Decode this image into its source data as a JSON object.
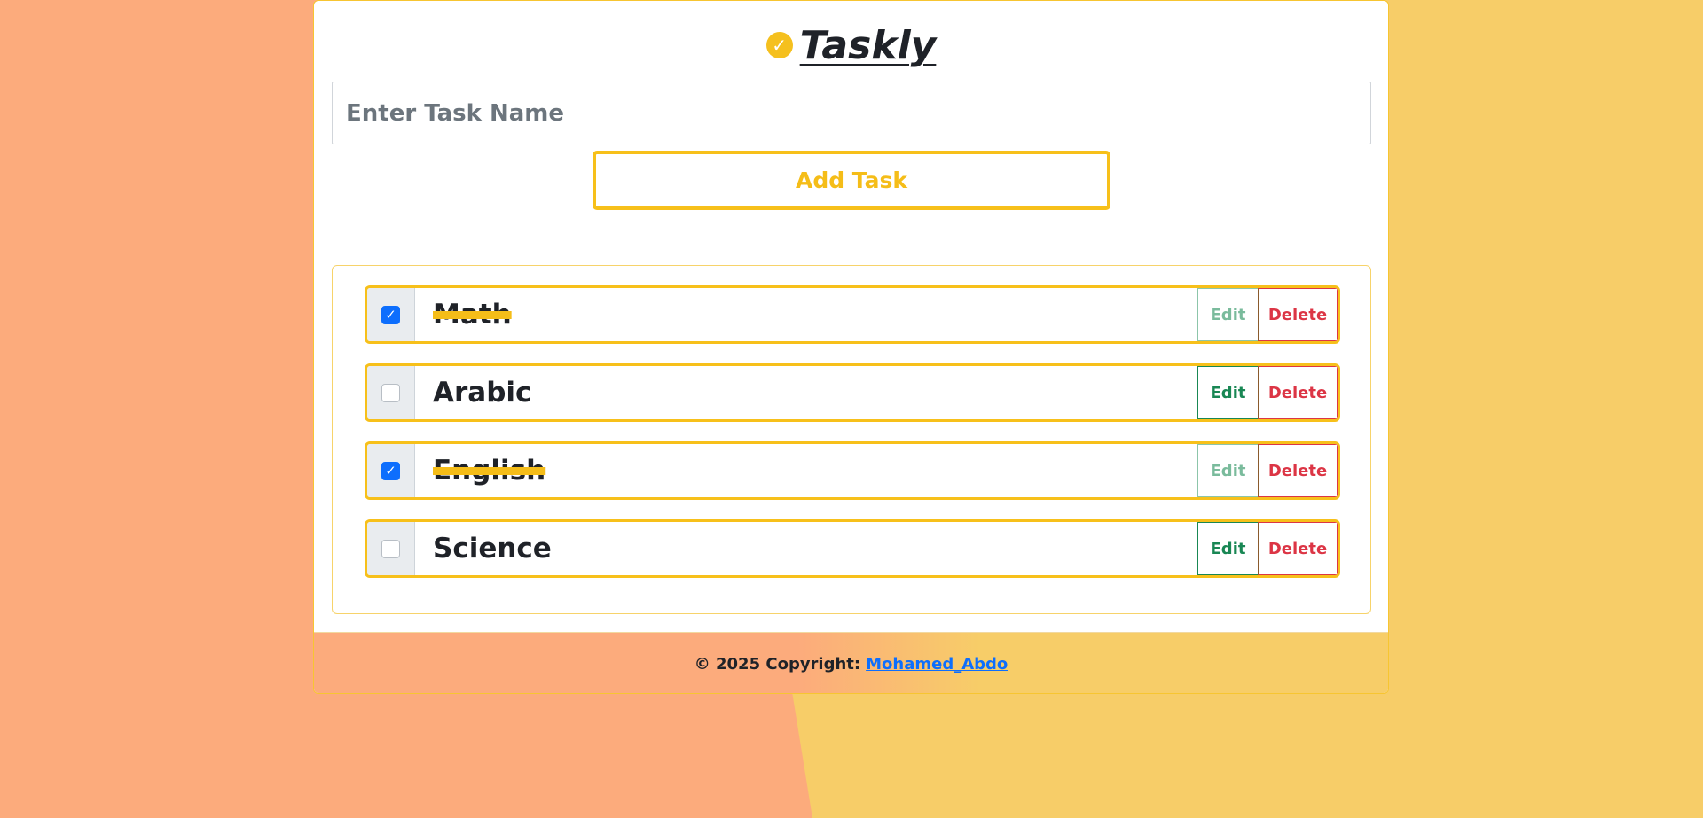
{
  "app": {
    "title": "Taskly",
    "title_icon": "check-circle-icon"
  },
  "form": {
    "input_placeholder": "Enter Task Name",
    "input_value": "",
    "add_button_label": "Add Task"
  },
  "tasks": [
    {
      "name": "Math",
      "done": true,
      "edit_label": "Edit",
      "delete_label": "Delete"
    },
    {
      "name": "Arabic",
      "done": false,
      "edit_label": "Edit",
      "delete_label": "Delete"
    },
    {
      "name": "English",
      "done": true,
      "edit_label": "Edit",
      "delete_label": "Delete"
    },
    {
      "name": "Science",
      "done": false,
      "edit_label": "Edit",
      "delete_label": "Delete"
    }
  ],
  "footer": {
    "copyright_text": "© 2025 Copyright:",
    "author_link": "Mohamed_Abdo"
  },
  "colors": {
    "accent": "#f5bd18",
    "bg_left": "#fcab7c",
    "bg_right": "#f7cd68",
    "edit": "#198754",
    "delete": "#dc3545",
    "checkbox": "#0d6efd"
  }
}
